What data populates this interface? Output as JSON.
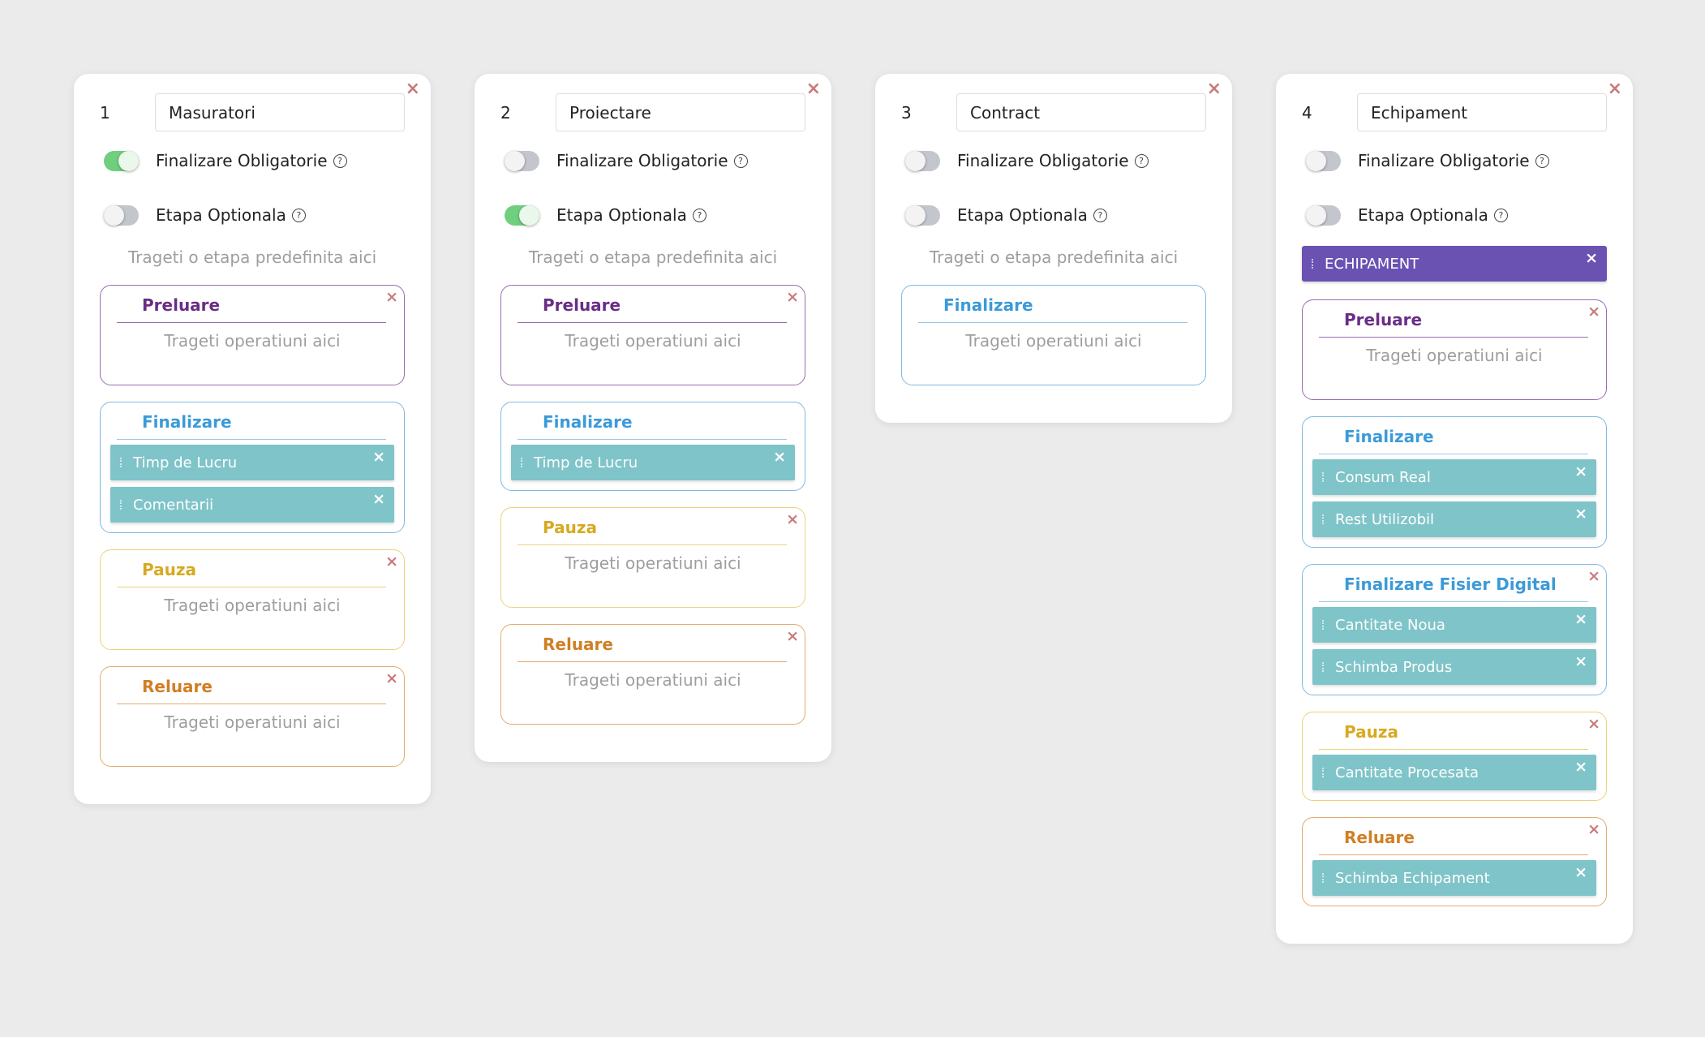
{
  "hints": {
    "drop_predefined": "Trageti o etapa predefinita aici",
    "drop_operations": "Trageti operatiuni aici"
  },
  "toggle_labels": {
    "required_finish": "Finalizare Obligatorie",
    "optional_stage": "Etapa Optionala"
  },
  "icons": {
    "close": "×",
    "help": "?"
  },
  "colors": {
    "background": "#ebebeb",
    "toggle_on": "#6fcf7e",
    "toggle_off": "#c3c6cc",
    "predefined_item": "#6a52b3",
    "operation_item": "#7fc4c9",
    "preluare": "#6a2d86",
    "finalizare": "#3c9ad8",
    "pauza": "#d7a921",
    "reluare": "#d07f24"
  },
  "stages": [
    {
      "number": "1",
      "name": "Masuratori",
      "required_finish": true,
      "optional_stage": false,
      "predefined": null,
      "sections": [
        {
          "kind": "preluare",
          "title": "Preluare",
          "closable": true,
          "operations": []
        },
        {
          "kind": "finalizare",
          "title": "Finalizare",
          "closable": false,
          "operations": [
            "Timp de Lucru",
            "Comentarii"
          ]
        },
        {
          "kind": "pauza",
          "title": "Pauza",
          "closable": true,
          "operations": []
        },
        {
          "kind": "reluare",
          "title": "Reluare",
          "closable": true,
          "operations": []
        }
      ]
    },
    {
      "number": "2",
      "name": "Proiectare",
      "required_finish": false,
      "optional_stage": true,
      "predefined": null,
      "sections": [
        {
          "kind": "preluare",
          "title": "Preluare",
          "closable": true,
          "operations": []
        },
        {
          "kind": "finalizare",
          "title": "Finalizare",
          "closable": false,
          "operations": [
            "Timp de Lucru"
          ]
        },
        {
          "kind": "pauza",
          "title": "Pauza",
          "closable": true,
          "operations": []
        },
        {
          "kind": "reluare",
          "title": "Reluare",
          "closable": true,
          "operations": []
        }
      ]
    },
    {
      "number": "3",
      "name": "Contract",
      "required_finish": false,
      "optional_stage": false,
      "predefined": null,
      "sections": [
        {
          "kind": "finalizare",
          "title": "Finalizare",
          "closable": false,
          "operations": []
        }
      ]
    },
    {
      "number": "4",
      "name": "Echipament",
      "required_finish": false,
      "optional_stage": false,
      "predefined": "ECHIPAMENT",
      "sections": [
        {
          "kind": "preluare",
          "title": "Preluare",
          "closable": true,
          "operations": []
        },
        {
          "kind": "finalizare",
          "title": "Finalizare",
          "closable": false,
          "operations": [
            "Consum Real",
            "Rest Utilizobil"
          ]
        },
        {
          "kind": "finalizare",
          "title": "Finalizare Fisier Digital",
          "closable": true,
          "operations": [
            "Cantitate Noua",
            "Schimba Produs"
          ]
        },
        {
          "kind": "pauza",
          "title": "Pauza",
          "closable": true,
          "operations": [
            "Cantitate Procesata"
          ]
        },
        {
          "kind": "reluare",
          "title": "Reluare",
          "closable": true,
          "operations": [
            "Schimba Echipament"
          ]
        }
      ]
    }
  ]
}
